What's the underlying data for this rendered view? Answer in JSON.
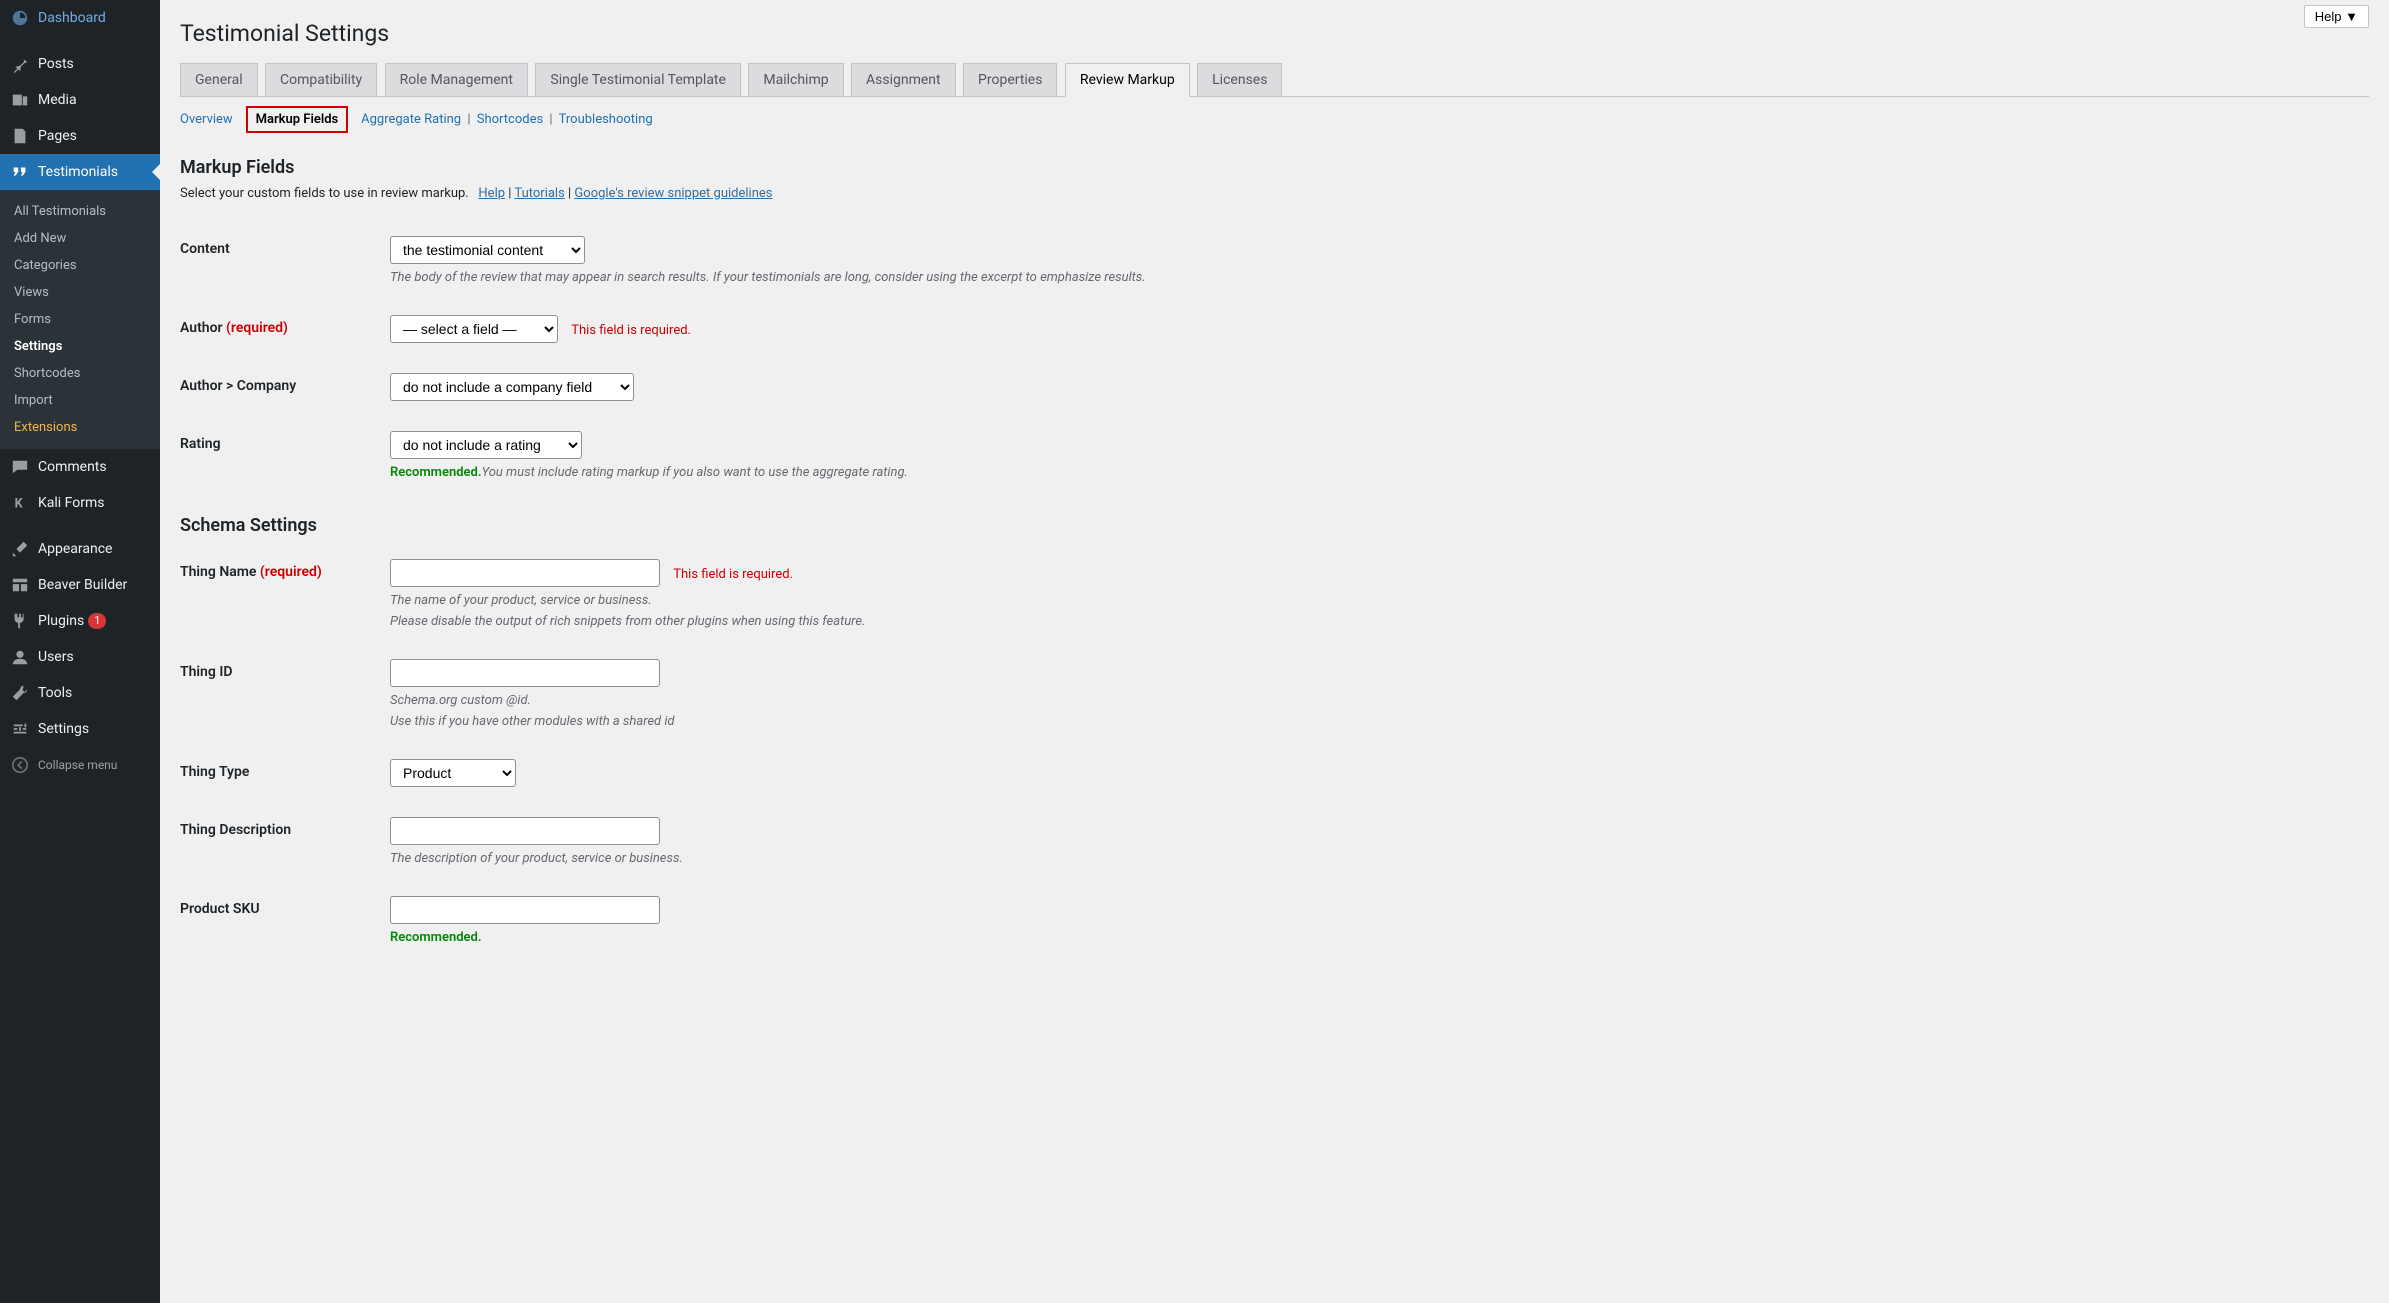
{
  "help_btn": "Help ▼",
  "page_title": "Testimonial Settings",
  "sidebar": {
    "items": [
      {
        "label": "Dashboard"
      },
      {
        "label": "Posts"
      },
      {
        "label": "Media"
      },
      {
        "label": "Pages"
      },
      {
        "label": "Testimonials"
      },
      {
        "label": "Comments"
      },
      {
        "label": "Kali Forms"
      },
      {
        "label": "Appearance"
      },
      {
        "label": "Beaver Builder"
      },
      {
        "label": "Plugins"
      },
      {
        "label": "Users"
      },
      {
        "label": "Tools"
      },
      {
        "label": "Settings"
      },
      {
        "label": "Collapse menu"
      }
    ],
    "plugins_badge": "1",
    "submenu": [
      {
        "label": "All Testimonials"
      },
      {
        "label": "Add New"
      },
      {
        "label": "Categories"
      },
      {
        "label": "Views"
      },
      {
        "label": "Forms"
      },
      {
        "label": "Settings"
      },
      {
        "label": "Shortcodes"
      },
      {
        "label": "Import"
      },
      {
        "label": "Extensions"
      }
    ]
  },
  "tabs": [
    {
      "label": "General"
    },
    {
      "label": "Compatibility"
    },
    {
      "label": "Role Management"
    },
    {
      "label": "Single Testimonial Template"
    },
    {
      "label": "Mailchimp"
    },
    {
      "label": "Assignment"
    },
    {
      "label": "Properties"
    },
    {
      "label": "Review Markup"
    },
    {
      "label": "Licenses"
    }
  ],
  "subtabs": {
    "overview": "Overview",
    "markup_fields": "Markup Fields",
    "aggregate_rating": "Aggregate Rating",
    "shortcodes": "Shortcodes",
    "troubleshooting": "Troubleshooting"
  },
  "markup_fields": {
    "heading": "Markup Fields",
    "intro": "Select your custom fields to use in review markup.",
    "help_link": "Help",
    "tutorials_link": "Tutorials",
    "google_link": "Google's review snippet guidelines",
    "content_label": "Content",
    "content_select": "the testimonial content",
    "content_desc": "The body of the review that may appear in search results. If your testimonials are long, consider using the excerpt to emphasize results.",
    "author_label": "Author",
    "author_required": " (required)",
    "author_select": "— select a field —",
    "author_error": "This field is required.",
    "author_company_label": "Author > Company",
    "author_company_select": "do not include a company field",
    "rating_label": "Rating",
    "rating_select": "do not include a rating",
    "rating_recommend": "Recommended.",
    "rating_desc": "You must include rating markup if you also want to use the aggregate rating."
  },
  "schema": {
    "heading": "Schema Settings",
    "thing_name_label": "Thing Name",
    "thing_name_required": " (required)",
    "thing_name_error": "This field is required.",
    "thing_name_desc1": "The name of your product, service or business.",
    "thing_name_desc2": "Please disable the output of rich snippets from other plugins when using this feature.",
    "thing_id_label": "Thing ID",
    "thing_id_desc1": "Schema.org custom @id.",
    "thing_id_desc2": "Use this if you have other modules with a shared id",
    "thing_type_label": "Thing Type",
    "thing_type_select": "Product",
    "thing_desc_label": "Thing Description",
    "thing_desc_desc": "The description of your product, service or business.",
    "product_sku_label": "Product SKU",
    "product_sku_recommend": "Recommended."
  }
}
